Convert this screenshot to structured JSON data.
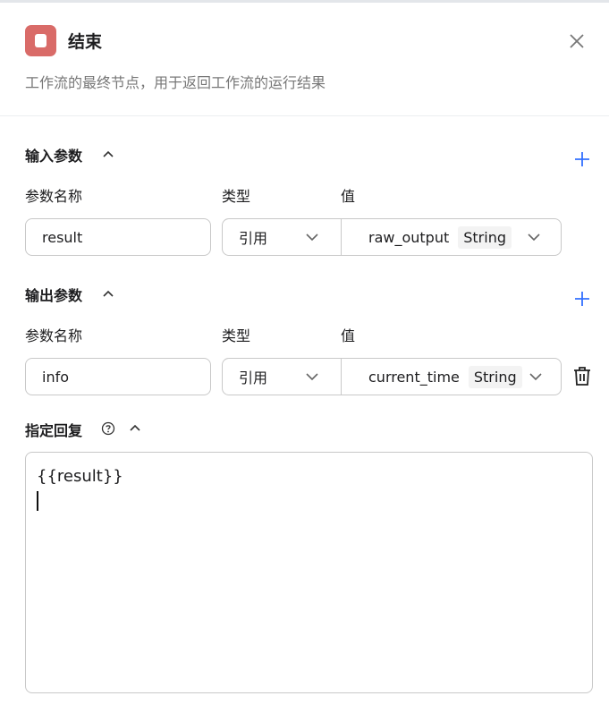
{
  "header": {
    "title": "结束",
    "description": "工作流的最终节点，用于返回工作流的运行结果",
    "icon": "stop-icon",
    "accent": "#d96b68"
  },
  "input_section": {
    "title": "输入参数",
    "col_name": "参数名称",
    "col_type": "类型",
    "col_value": "值",
    "rows": [
      {
        "name": "result",
        "type": "引用",
        "value": "raw_output",
        "value_type": "String"
      }
    ]
  },
  "output_section": {
    "title": "输出参数",
    "col_name": "参数名称",
    "col_type": "类型",
    "col_value": "值",
    "rows": [
      {
        "name": "info",
        "type": "引用",
        "value": "current_time",
        "value_type": "String"
      }
    ]
  },
  "reply_section": {
    "title": "指定回复",
    "content": "{{result}}"
  }
}
